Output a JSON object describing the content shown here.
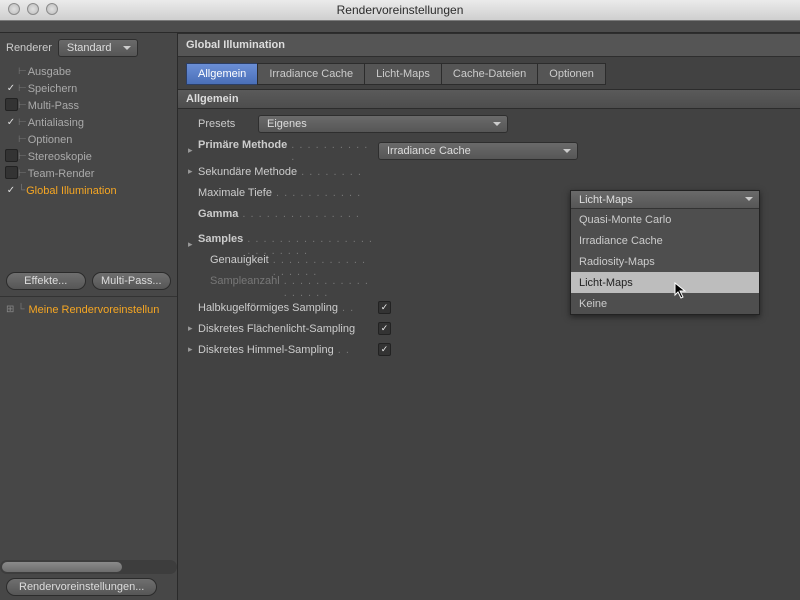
{
  "window": {
    "title": "Rendervoreinstellungen"
  },
  "sidebar": {
    "renderer_label": "Renderer",
    "renderer_value": "Standard",
    "items": [
      {
        "checked": "",
        "branch": "⊢",
        "label": "Ausgabe",
        "selected": false
      },
      {
        "checked": "✓",
        "branch": "⊢",
        "label": "Speichern",
        "selected": false
      },
      {
        "checked": "",
        "branch": "⊢",
        "label": "Multi-Pass",
        "selected": false,
        "box": true
      },
      {
        "checked": "✓",
        "branch": "⊢",
        "label": "Antialiasing",
        "selected": false
      },
      {
        "checked": "",
        "branch": "⊢",
        "label": "Optionen",
        "selected": false
      },
      {
        "checked": "",
        "branch": "⊢",
        "label": "Stereoskopie",
        "selected": false,
        "box": true
      },
      {
        "checked": "",
        "branch": "⊢",
        "label": "Team-Render",
        "selected": false,
        "box": true
      },
      {
        "checked": "✓",
        "branch": "∟",
        "label": "Global Illumination",
        "selected": true
      }
    ],
    "btn_effects": "Effekte...",
    "btn_multipass": "Multi-Pass...",
    "preset_row": "Meine Rendervoreinstellun",
    "bottom_tab": "Rendervoreinstellungen..."
  },
  "panel": {
    "title": "Global Illumination",
    "tabs": [
      {
        "label": "Allgemein",
        "active": true
      },
      {
        "label": "Irradiance Cache",
        "active": false
      },
      {
        "label": "Licht-Maps",
        "active": false
      },
      {
        "label": "Cache-Dateien",
        "active": false
      },
      {
        "label": "Optionen",
        "active": false
      }
    ],
    "section_general": "Allgemein",
    "presets_label": "Presets",
    "presets_value": "Eigenes",
    "rows": {
      "primary_label": "Primäre Methode",
      "primary_value": "Irradiance Cache",
      "secondary_label": "Sekundäre Methode",
      "secondary_value": "Licht-Maps",
      "maxdepth_label": "Maximale Tiefe",
      "gamma_label": "Gamma",
      "samples_label": "Samples",
      "accuracy_label": "Genauigkeit",
      "samplecount_label": "Sampleanzahl",
      "hemi_label": "Halbkugelförmiges Sampling",
      "area_label": "Diskretes Flächenlicht-Sampling",
      "sky_label": "Diskretes Himmel-Sampling"
    },
    "dropdown": {
      "current": "Licht-Maps",
      "options": [
        {
          "label": "Quasi-Monte Carlo",
          "hover": false
        },
        {
          "label": "Irradiance Cache",
          "hover": false
        },
        {
          "label": "Radiosity-Maps",
          "hover": false
        },
        {
          "label": "Licht-Maps",
          "hover": true
        },
        {
          "label": "Keine",
          "hover": false
        }
      ]
    }
  }
}
